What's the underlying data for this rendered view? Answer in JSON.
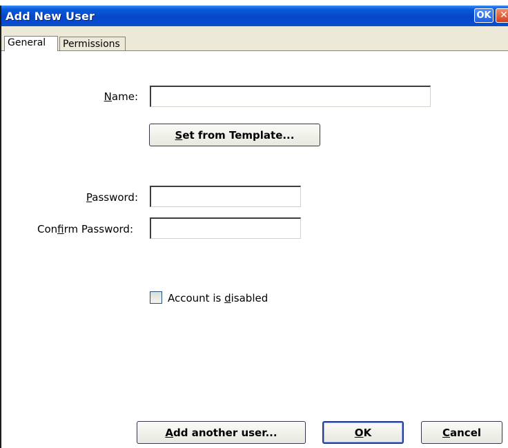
{
  "window": {
    "title": "Add New User",
    "ok_label": "OK",
    "close_label": "✕"
  },
  "tabs": [
    {
      "label": "General",
      "active": true
    },
    {
      "label": "Permissions",
      "active": false
    }
  ],
  "form": {
    "name": {
      "label_pre": "",
      "label_ul": "N",
      "label_post": "ame:",
      "value": ""
    },
    "template_button": {
      "pre": "",
      "ul": "S",
      "post": "et from Template..."
    },
    "password": {
      "label_pre": "",
      "label_ul": "P",
      "label_post": "assword:",
      "value": ""
    },
    "confirm": {
      "label_pre": "Con",
      "label_ul": "f",
      "label_post": "irm Password:",
      "value": ""
    },
    "disabled": {
      "label_pre": "Account is ",
      "label_ul": "d",
      "label_post": "isabled",
      "checked": false
    }
  },
  "footer": {
    "add_another": {
      "pre": "",
      "ul": "A",
      "post": "dd another user..."
    },
    "ok": {
      "pre": "",
      "ul": "O",
      "post": "K"
    },
    "cancel": {
      "pre": "",
      "ul": "C",
      "post": "ancel"
    }
  }
}
